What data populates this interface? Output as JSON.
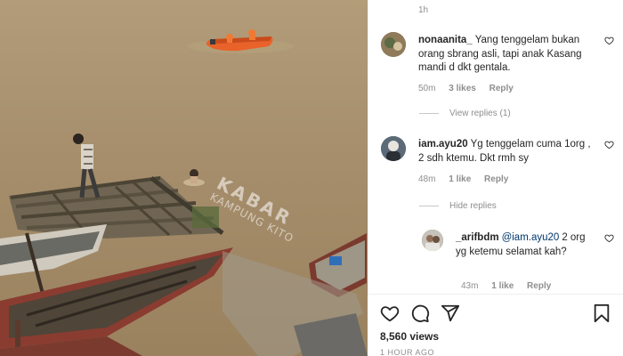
{
  "media": {
    "watermark_line1": "KABAR",
    "watermark_line2": "KAMPUNG KITO",
    "description_icon": "video-frame"
  },
  "comments_top": {
    "timestamp": "1h"
  },
  "comments": [
    {
      "username": "nonaanita_",
      "text": "Yang tenggelam bukan orang sbrang asli, tapi anak Kasang mandi d dkt gentala.",
      "time": "50m",
      "likes": "3 likes",
      "reply_label": "Reply"
    },
    {
      "username": "iam.ayu20",
      "text": "Yg tenggelam cuma 1org , 2 sdh ktemu. Dkt rmh sy",
      "time": "48m",
      "likes": "1 like",
      "reply_label": "Reply"
    },
    {
      "username": "_arifbdm",
      "mention": "@iam.ayu20",
      "text": "2 org yg ketemu selamat kah?",
      "time": "43m",
      "likes": "1 like",
      "reply_label": "Reply"
    }
  ],
  "view_replies": {
    "label": "View replies (1)"
  },
  "hide_replies": {
    "label": "Hide replies"
  },
  "actions": {
    "like_icon": "heart-icon",
    "comment_icon": "comment-icon",
    "share_icon": "share-icon",
    "save_icon": "bookmark-icon"
  },
  "stats": {
    "views": "8,560 views",
    "posted": "1 HOUR AGO"
  },
  "colors": {
    "river": "#a68e6c",
    "boat_orange": "#e8622a",
    "boat_red": "#8a3c30",
    "text_muted": "#8e8e8e"
  }
}
